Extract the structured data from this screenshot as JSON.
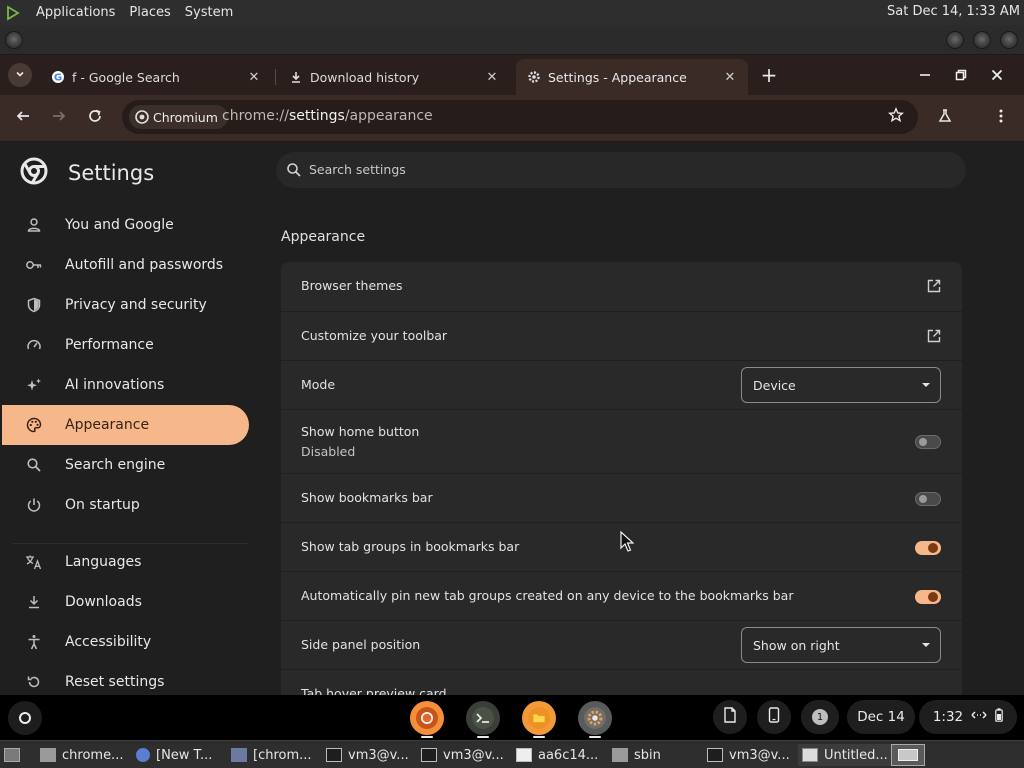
{
  "system_panel": {
    "menus": [
      "Applications",
      "Places",
      "System"
    ],
    "clock": "Sat Dec 14,  1:33 AM"
  },
  "browser": {
    "tabs": [
      {
        "title": "f - Google Search",
        "favicon": "google-g-icon",
        "active": false
      },
      {
        "title": "Download history",
        "favicon": "download-icon",
        "active": false
      },
      {
        "title": "Settings - Appearance",
        "favicon": "gear-icon",
        "active": true
      }
    ],
    "omnibox": {
      "chip_label": "Chromium",
      "url_prefix": "chrome://",
      "url_host": "settings",
      "url_path": "/appearance"
    }
  },
  "settings": {
    "title": "Settings",
    "search_placeholder": "Search settings",
    "nav": [
      {
        "label": "You and Google",
        "icon": "person-icon"
      },
      {
        "label": "Autofill and passwords",
        "icon": "key-icon"
      },
      {
        "label": "Privacy and security",
        "icon": "shield-icon"
      },
      {
        "label": "Performance",
        "icon": "speedometer-icon"
      },
      {
        "label": "AI innovations",
        "icon": "sparkle-icon"
      },
      {
        "label": "Appearance",
        "icon": "palette-icon",
        "active": true
      },
      {
        "label": "Search engine",
        "icon": "search-icon"
      },
      {
        "label": "On startup",
        "icon": "power-icon"
      },
      {
        "label": "Languages",
        "icon": "translate-icon"
      },
      {
        "label": "Downloads",
        "icon": "download-icon"
      },
      {
        "label": "Accessibility",
        "icon": "accessibility-icon"
      },
      {
        "label": "Reset settings",
        "icon": "reset-icon"
      }
    ],
    "section_title": "Appearance",
    "rows": [
      {
        "label": "Browser themes",
        "control": "external-link"
      },
      {
        "label": "Customize your toolbar",
        "control": "external-link"
      },
      {
        "label": "Mode",
        "control": "dropdown",
        "value": "Device"
      },
      {
        "label": "Show home button",
        "sublabel": "Disabled",
        "control": "toggle",
        "checked": false
      },
      {
        "label": "Show bookmarks bar",
        "control": "toggle",
        "checked": false
      },
      {
        "label": "Show tab groups in bookmarks bar",
        "control": "toggle",
        "checked": true
      },
      {
        "label": "Automatically pin new tab groups created on any device to the bookmarks bar",
        "control": "toggle",
        "checked": true
      },
      {
        "label": "Side panel position",
        "control": "dropdown",
        "value": "Show on right"
      },
      {
        "label": "Tab hover preview card",
        "control": "none"
      }
    ]
  },
  "shelf": {
    "apps": [
      "chromium-icon",
      "terminal-icon",
      "files-icon",
      "settings-gear-icon"
    ],
    "notification_count": "1",
    "date": "Dec 14",
    "time": "1:32"
  },
  "taskbar": {
    "items": [
      {
        "label": "chrome...",
        "icon": "folder-icon"
      },
      {
        "label": "[New T...",
        "icon": "chromium-icon"
      },
      {
        "label": "[chrom...",
        "icon": "app-icon"
      },
      {
        "label": "vm3@v...",
        "icon": "terminal-icon"
      },
      {
        "label": "vm3@v...",
        "icon": "terminal-icon"
      },
      {
        "label": "aa6c14...",
        "icon": "terminal-icon"
      },
      {
        "label": "sbin",
        "icon": "folder-icon"
      },
      {
        "label": "vm3@v...",
        "icon": "terminal-icon"
      },
      {
        "label": "Untitled...",
        "icon": "window-icon",
        "active": true
      }
    ]
  },
  "colors": {
    "accent": "#f6b88b",
    "toggle_knob_on": "#7a3a14",
    "frame": "#2a1f1c",
    "toolbar": "#3a2b27",
    "page_bg": "#1f1f1f",
    "card_bg": "#292929"
  }
}
